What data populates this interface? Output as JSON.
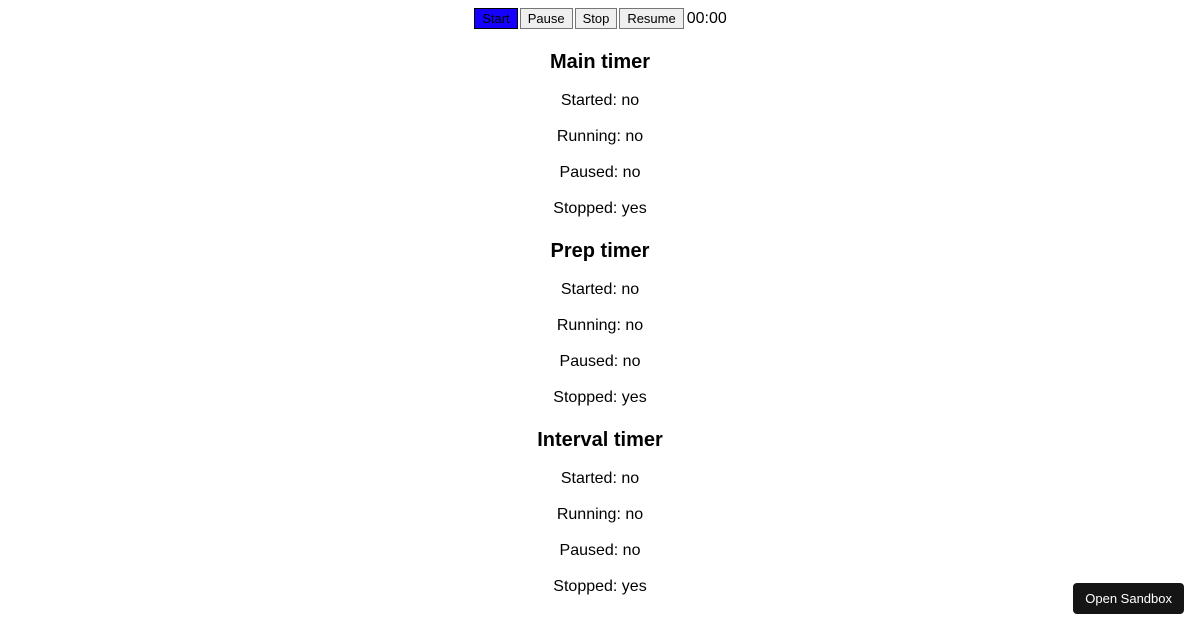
{
  "controls": {
    "start": "Start",
    "pause": "Pause",
    "stop": "Stop",
    "resume": "Resume"
  },
  "timer_display": "00:00",
  "timers": {
    "main": {
      "title": "Main timer",
      "started_label": "Started: ",
      "started": "no",
      "running_label": "Running: ",
      "running": "no",
      "paused_label": "Paused: ",
      "paused": "no",
      "stopped_label": "Stopped: ",
      "stopped": "yes"
    },
    "prep": {
      "title": "Prep timer",
      "started_label": "Started: ",
      "started": "no",
      "running_label": "Running: ",
      "running": "no",
      "paused_label": "Paused: ",
      "paused": "no",
      "stopped_label": "Stopped: ",
      "stopped": "yes"
    },
    "interval": {
      "title": "Interval timer",
      "started_label": "Started: ",
      "started": "no",
      "running_label": "Running: ",
      "running": "no",
      "paused_label": "Paused: ",
      "paused": "no",
      "stopped_label": "Stopped: ",
      "stopped": "yes"
    }
  },
  "sandbox_button": "Open Sandbox"
}
